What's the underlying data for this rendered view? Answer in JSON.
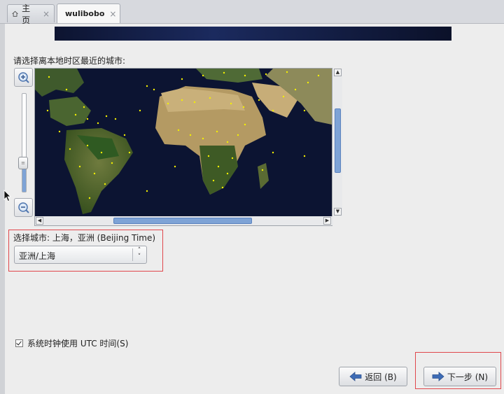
{
  "tabs": [
    {
      "label": "主页",
      "icon": "home-icon",
      "close": "×"
    },
    {
      "label": "wulibobo",
      "icon": "vm-icon",
      "close": "×"
    }
  ],
  "timezone": {
    "prompt": "请选择离本地时区最近的城市:",
    "selected_city_label": "选择城市: 上海，亚洲 (Beijing Time)",
    "selected_value": "亚洲/上海"
  },
  "options": {
    "utc_label": "系统时钟使用 UTC 时间(S)",
    "utc_checked": true
  },
  "buttons": {
    "back": "返回 (B)",
    "next": "下一步 (N)"
  },
  "colors": {
    "highlight": "#e0474c",
    "accent": "#3d6bb5",
    "map_ocean": "#0d1534"
  }
}
